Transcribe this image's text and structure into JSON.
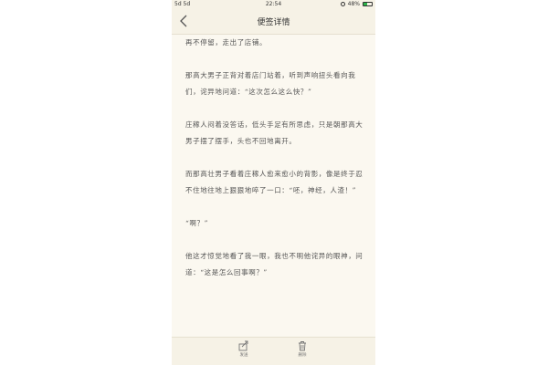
{
  "status_bar": {
    "signal_text": "5d 5d",
    "time": "22:54",
    "battery_percent_text": "48%",
    "battery_level": 0.48,
    "battery_color": "#2db34a"
  },
  "nav": {
    "back_icon": "chevron-left-icon",
    "title": "便签详情"
  },
  "content": {
    "paragraphs": [
      "再不停留，走出了店铺。",
      "那高大男子正背对着店门站着，听到声响扭头看向我们，诧异地问道：“这次怎么这么快？”",
      "庄稼人闷着没答话，低头手足有所思虑，只是朝那高大男子摆了摆手，头也不回地离开。",
      "而那高壮男子看着庄稼人愈来愈小的背影，像是终于忍不住地往地上狠狠地啐了一口：“呸，神经，人渣！”",
      "“啊？”",
      "他这才惊觉地看了我一眼，我也不明他诧异的眼神，问道：“这是怎么回事啊？”"
    ]
  },
  "bottom_bar": {
    "send_label": "发送",
    "send_icon": "share-icon",
    "delete_label": "删除",
    "delete_icon": "trash-icon"
  },
  "colors": {
    "page_background": "#fbf8f0",
    "bar_background": "#f6f2e6",
    "text": "#555555"
  }
}
